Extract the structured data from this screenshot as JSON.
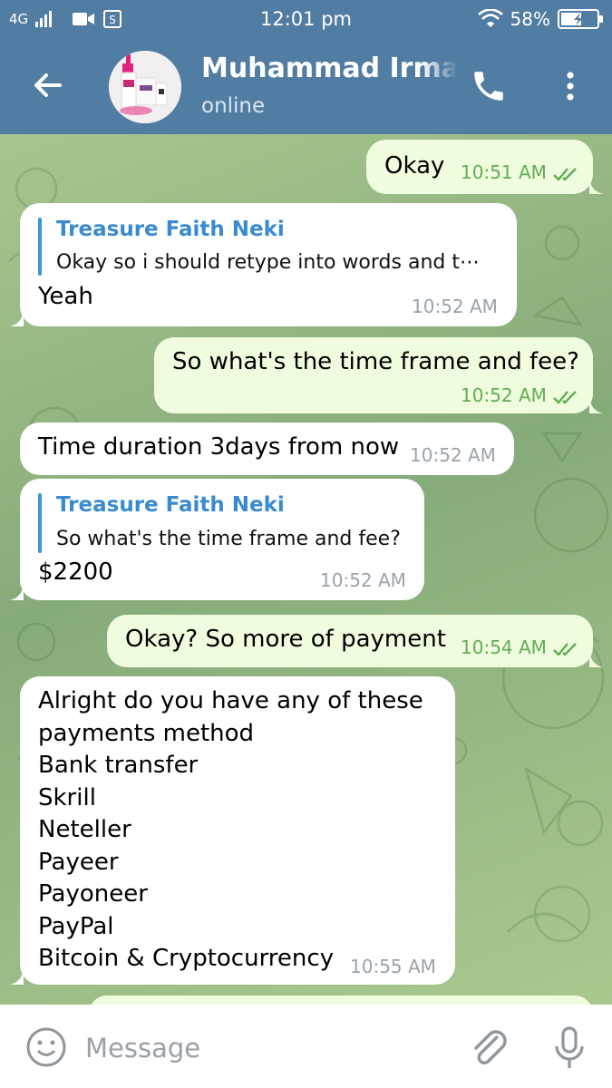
{
  "status_bar": {
    "network": "4G",
    "time": "12:01 pm",
    "battery": "58%",
    "battery_level": 0.58
  },
  "header": {
    "title": "Muhammad Irman",
    "subtitle": "online",
    "icons": [
      "back-arrow-icon",
      "contact-avatar",
      "phone-icon",
      "more-vert-icon"
    ]
  },
  "messages": [
    {
      "direction": "out",
      "text": "Okay",
      "time": "10:51 AM",
      "read": true
    },
    {
      "direction": "in",
      "reply_name": "Treasure Faith Neki",
      "reply_text": "Okay so i should retype into words and t⋯",
      "text": "Yeah",
      "time": "10:52 AM"
    },
    {
      "direction": "out",
      "text": "So what's the time frame and fee?",
      "time": "10:52 AM",
      "read": true
    },
    {
      "direction": "in",
      "text": "Time duration 3days from now",
      "time": "10:52 AM"
    },
    {
      "direction": "in",
      "reply_name": "Treasure Faith Neki",
      "reply_text": "So what's the time frame and fee?",
      "text": "$2200",
      "time": "10:52 AM"
    },
    {
      "direction": "out",
      "text": "Okay? So more of payment",
      "time": "10:54 AM",
      "read": true
    },
    {
      "direction": "in",
      "text": "Alright do you have any of these\npayments method\nBank transfer\nSkrill\nNeteller\nPayeer\nPayoneer\nPayPal\nBitcoin & Cryptocurrency",
      "time": "10:55 AM"
    }
  ],
  "composer": {
    "placeholder": "Message",
    "icons": [
      "emoji-icon",
      "attach-icon",
      "mic-icon"
    ]
  },
  "colors": {
    "header": "#527da3",
    "incoming_bubble": "#ffffff",
    "outgoing_bubble": "#effdde",
    "outgoing_time": "#62ac55",
    "reply_name": "#3a8ad0"
  }
}
